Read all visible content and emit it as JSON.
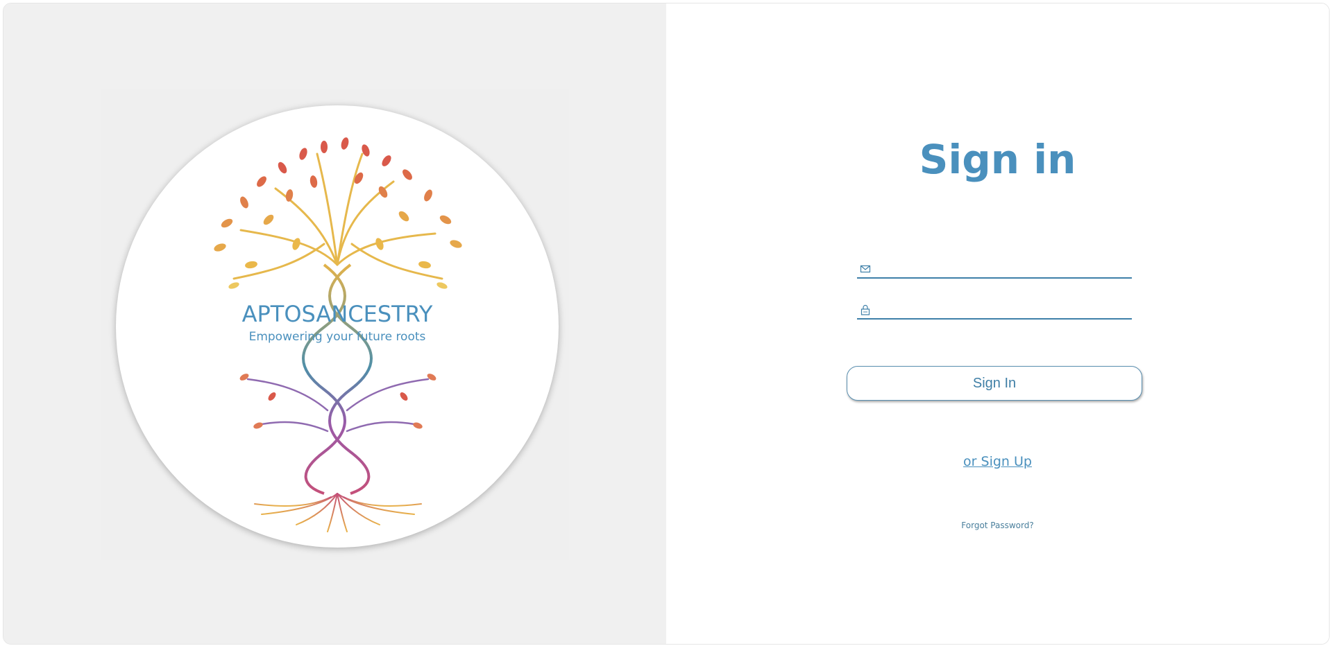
{
  "brand": {
    "logo_name": "APTOSANCESTRY",
    "tagline": "Empowering your future roots"
  },
  "signin": {
    "title": "Sign in",
    "email_placeholder": "",
    "password_placeholder": "",
    "email_icon": "envelope-icon",
    "password_icon": "lock-icon",
    "submit_label": "Sign In",
    "signup_label": "or Sign Up",
    "forgot_label": "Forgot Password?"
  },
  "colors": {
    "accent": "#4a90bd",
    "field_underline": "#3d7fa8",
    "left_panel_bg": "#f0f0f0",
    "right_panel_bg": "#ffffff"
  }
}
